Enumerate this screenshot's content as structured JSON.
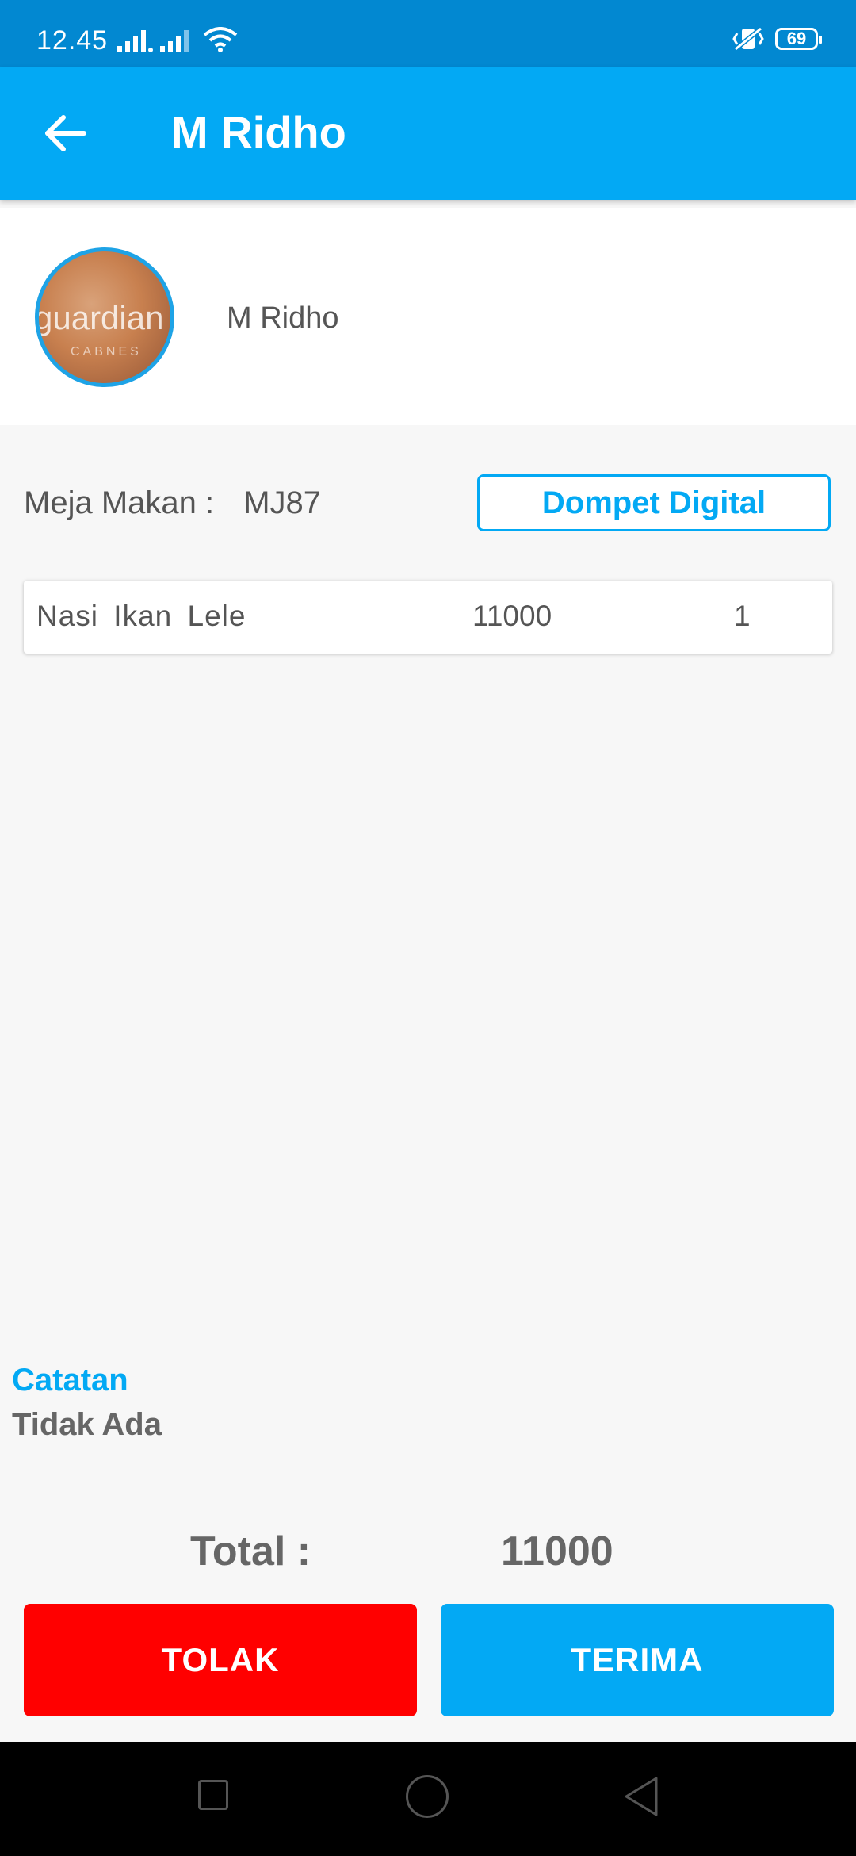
{
  "status_bar": {
    "time": "12.45",
    "battery": "69",
    "icons": [
      "signal-icon",
      "signal-icon",
      "wifi-icon",
      "vibrate-icon",
      "battery-icon"
    ]
  },
  "app_bar": {
    "title": "M Ridho",
    "back_icon": "arrow-left-icon"
  },
  "profile": {
    "name": "M Ridho",
    "avatar_text": "guardian",
    "avatar_subtext": "CABNES"
  },
  "order": {
    "table_label": "Meja Makan :",
    "table_value": "MJ87",
    "payment_button": "Dompet Digital",
    "items": [
      {
        "name": "Nasi Ikan Lele",
        "price": "11000",
        "qty": "1"
      }
    ]
  },
  "notes": {
    "title": "Catatan",
    "value": "Tidak Ada"
  },
  "total": {
    "label": "Total :",
    "value": "11000"
  },
  "actions": {
    "reject": "TOLAK",
    "accept": "TERIMA"
  },
  "colors": {
    "status_bar": "#0288d1",
    "primary": "#03a9f4",
    "reject": "#ff0000",
    "text": "#555555"
  }
}
